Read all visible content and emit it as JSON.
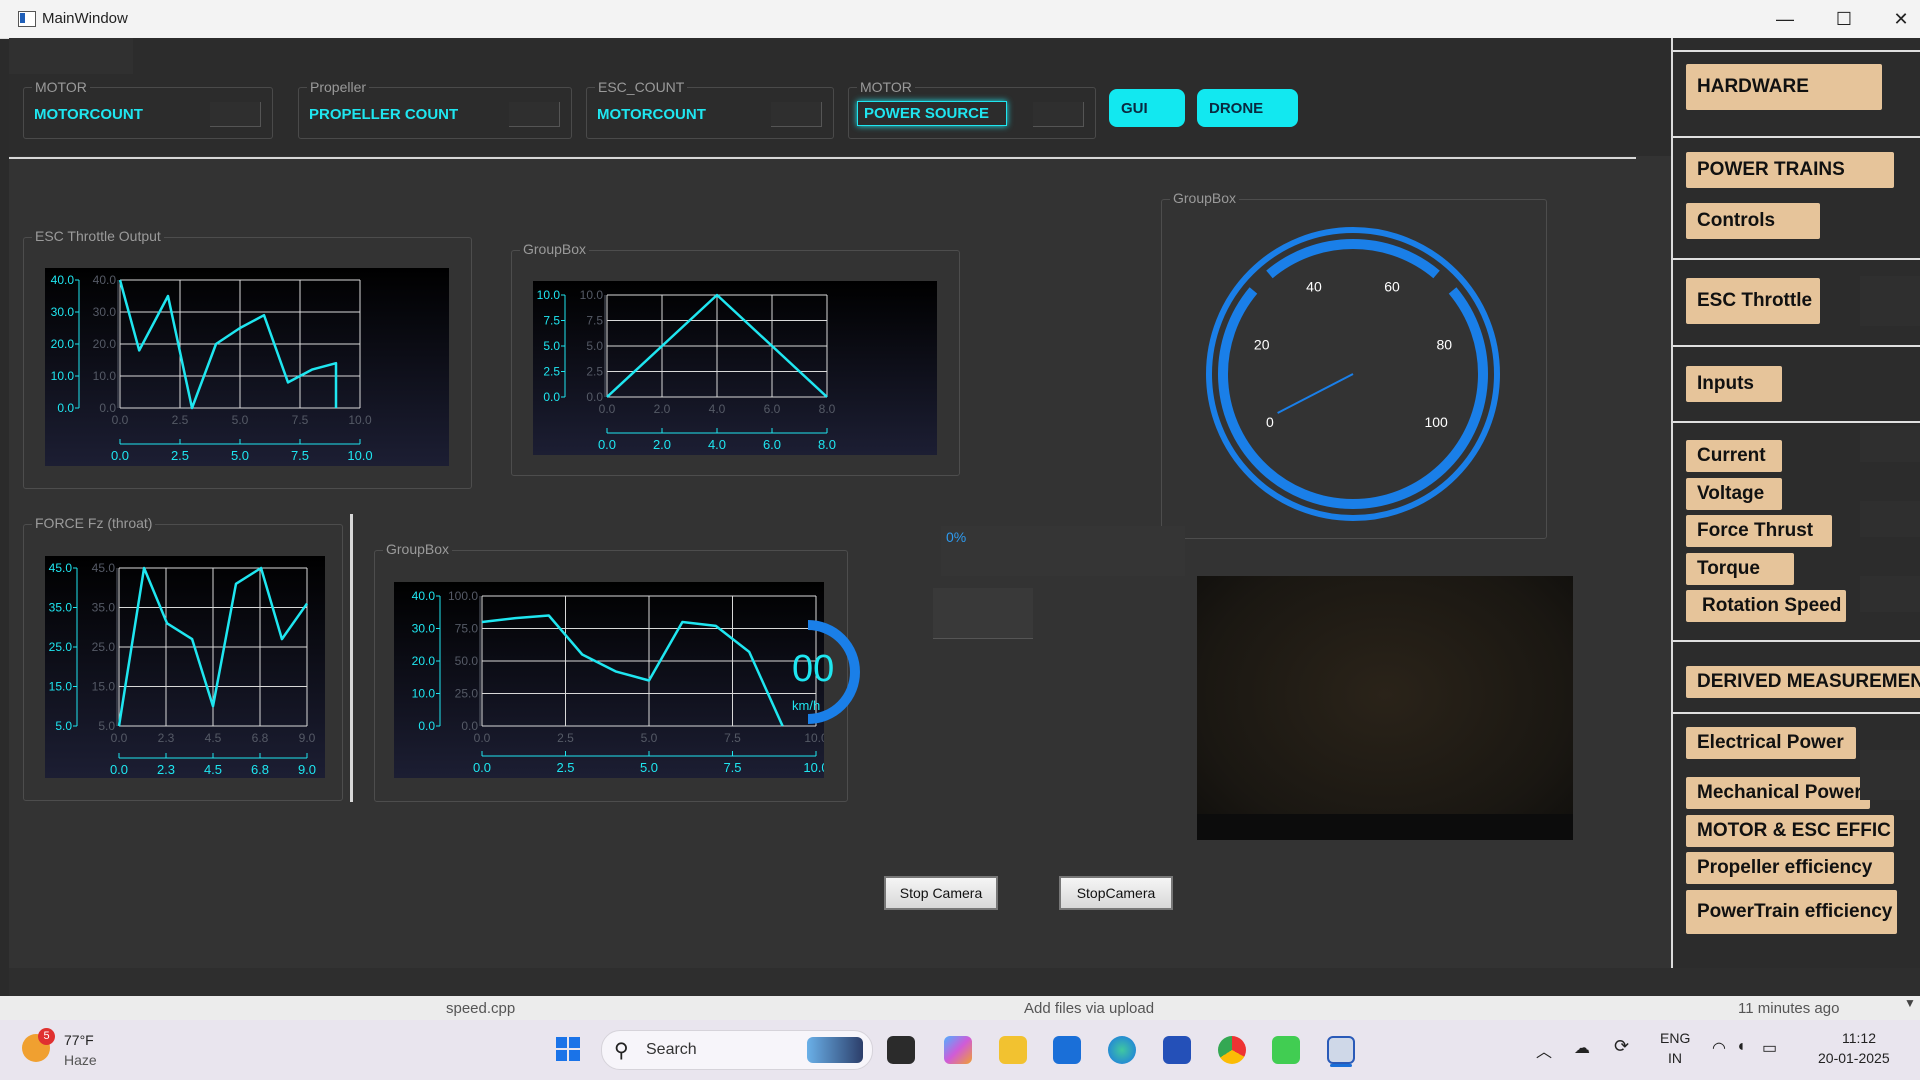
{
  "window": {
    "title": "MainWindow"
  },
  "top_groups": [
    {
      "group_label": "MOTOR",
      "text": "MOTORCOUNT"
    },
    {
      "group_label": "Propeller",
      "text": "PROPELLER COUNT"
    },
    {
      "group_label": "ESC_COUNT",
      "text": "MOTORCOUNT"
    },
    {
      "group_label": "MOTOR",
      "text": "POWER SOURCE"
    }
  ],
  "top_buttons": {
    "gui": "GUI",
    "drone": "DRONE"
  },
  "sidebar": {
    "hardware": "HARDWARE",
    "power_trains": "POWER TRAINS",
    "controls": "Controls",
    "esc_throttle": "ESC Throttle",
    "inputs": "Inputs",
    "current": "Current",
    "voltage": "Voltage",
    "force_thrust": "Force Thrust",
    "torque": "Torque",
    "rotation_speed": "Rotation Speed",
    "derived": "DERIVED MEASUREMEN",
    "electrical_power": "Electrical Power",
    "mechanical_power": "Mechanical Power",
    "motor_esc_eff": "MOTOR & ESC EFFIC",
    "propeller_eff": "Propeller efficiency",
    "powertrain_eff": "PowerTrain efficiency"
  },
  "groupboxes": {
    "esc_throttle_output": "ESC Throttle Output",
    "groupbox_tri": "GroupBox",
    "force_fz": "FORCE Fz (throat)",
    "groupbox_speed": "GroupBox",
    "groupbox_gauge": "GroupBox"
  },
  "progress_text": "0%",
  "speed": {
    "value": "00",
    "unit": "km/h"
  },
  "buttons": {
    "stop_camera_1": "Stop Camera",
    "stop_camera_2": "StopCamera"
  },
  "taskbar": {
    "weather_temp": "77°F",
    "weather_desc": "Haze",
    "weather_badge": "5",
    "search": "Search",
    "lang1": "ENG",
    "lang2": "IN",
    "time": "11:12",
    "date": "20-01-2025"
  },
  "behind_window": {
    "left": "speed.cpp",
    "mid": "Add files via upload",
    "right": "11 minutes ago"
  },
  "colors": {
    "accent_cyan": "#1fe6f0",
    "sidebar_button": "#e6c49a",
    "gauge_blue": "#1a7fe8"
  },
  "gauge": {
    "labels": [
      "0",
      "20",
      "40",
      "60",
      "80",
      "100"
    ],
    "value": 0
  },
  "chart_data": [
    {
      "id": "esc",
      "type": "line",
      "title": "ESC Throttle Output",
      "x": [
        0,
        0.8,
        2.0,
        3.0,
        4.0,
        5.0,
        6.0,
        7.0,
        8.0,
        9.0,
        9.0
      ],
      "y": [
        40,
        18,
        35,
        0,
        20,
        25,
        29,
        8,
        12,
        14,
        0
      ],
      "xlim": [
        0,
        10
      ],
      "ylim": [
        0,
        40
      ],
      "xticks": [
        "0.0",
        "2.5",
        "5.0",
        "7.5",
        "10.0"
      ],
      "yticks": [
        "0.0",
        "10.0",
        "20.0",
        "30.0",
        "40.0"
      ]
    },
    {
      "id": "tri",
      "type": "line",
      "title": "GroupBox",
      "x": [
        0,
        4,
        8
      ],
      "y": [
        0,
        10,
        0
      ],
      "xlim": [
        0,
        8
      ],
      "ylim": [
        0,
        10
      ],
      "xticks": [
        "0.0",
        "2.0",
        "4.0",
        "6.0",
        "8.0"
      ],
      "yticks": [
        "0.0",
        "2.5",
        "5.0",
        "7.5",
        "10.0"
      ]
    },
    {
      "id": "force",
      "type": "line",
      "title": "FORCE Fz (throat)",
      "x": [
        0,
        1.2,
        2.3,
        3.5,
        4.5,
        5.6,
        6.8,
        7.8,
        9.0
      ],
      "y": [
        5,
        45,
        31,
        27,
        10,
        41,
        45,
        27,
        36
      ],
      "xlim": [
        0,
        9
      ],
      "ylim": [
        5,
        45
      ],
      "xticks": [
        "0.0",
        "2.3",
        "4.5",
        "6.8",
        "9.0"
      ],
      "yticks": [
        "5.0",
        "15.0",
        "25.0",
        "35.0",
        "45.0"
      ]
    },
    {
      "id": "speed",
      "type": "line",
      "title": "GroupBox",
      "x": [
        0,
        1.0,
        2.0,
        3.0,
        4.0,
        5.0,
        6.0,
        7.0,
        8.0,
        9.0
      ],
      "y": [
        80,
        83,
        85,
        55,
        42,
        35,
        80,
        77,
        57,
        0
      ],
      "xlim": [
        0,
        10
      ],
      "ylim": [
        0,
        100
      ],
      "xticks": [
        "0.0",
        "2.5",
        "5.0",
        "7.5",
        "10.0"
      ],
      "yticks": [
        "0.0",
        "10.0",
        "20.0",
        "30.0",
        "40.0"
      ],
      "yticks_inner": [
        "0.0",
        "25.0",
        "50.0",
        "75.0",
        "100.0"
      ]
    }
  ]
}
